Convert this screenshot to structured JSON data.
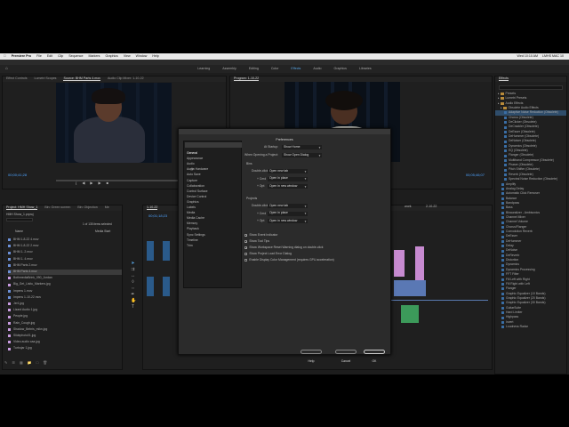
{
  "menubar": {
    "apple": "",
    "app": "Premiere Pro",
    "items": [
      "File",
      "Edit",
      "Clip",
      "Sequence",
      "Markers",
      "Graphics",
      "View",
      "Window",
      "Help"
    ],
    "right": [
      "Wed 10:10 AM",
      "LMHS MAC 10"
    ]
  },
  "titlebar": "/Volumes/ML/HMH Show/HMH Show_1.prproj *",
  "workspaces": [
    "Learning",
    "Assembly",
    "Editing",
    "Color",
    "Effects",
    "Audio",
    "Graphics",
    "Libraries"
  ],
  "active_workspace": "Effects",
  "source_tabs": [
    "Effect Controls",
    "Lumetri Scopes",
    "Source: BHM Parts 4.mov",
    "Audio Clip Mixer: 1-10-22"
  ],
  "program_tab": "Program: 1-10-22",
  "source_timecode": "00;00;41;28",
  "program_timecode_right": "00;05;46;07",
  "project": {
    "tabs": [
      "Project: HMH Show_1",
      "Bin: Green screen",
      "Bin: Objection",
      "Me"
    ],
    "file": "HMH Show_1.prproj",
    "count": "1 of 135 items selected",
    "col_name": "Name",
    "col_rate": "Media Start",
    "rows": [
      {
        "name": "BHM 1-8-22 4.mov",
        "color": "#6b8fd6"
      },
      {
        "name": "BHM 1-8-22 2.mov",
        "color": "#6b8fd6"
      },
      {
        "name": "BHM 1- 2.mov",
        "color": "#6b8fd6"
      },
      {
        "name": "BHM 1- 4.mov",
        "color": "#6b8fd6"
      },
      {
        "name": "BHM Parts 2.mov",
        "color": "#6b8fd6"
      },
      {
        "name": "BHM Parts 4.mov",
        "color": "#6b8fd6"
      },
      {
        "name": "BothmediaBrink_090_Jordan",
        "color": "#c89be0"
      },
      {
        "name": "Big_Get_Lisitu_Markers.jpg",
        "color": "#c89be0"
      },
      {
        "name": "Impens 1.mov",
        "color": "#6b8fd6"
      },
      {
        "name": "Impens 1-10-22.mov",
        "color": "#6b8fd6"
      },
      {
        "name": "Jer1.jpg",
        "color": "#c89be0"
      },
      {
        "name": "Lizard Audio 1.jpg",
        "color": "#c89be0"
      },
      {
        "name": "People.jpg",
        "color": "#c89be0"
      },
      {
        "name": "Rain_Cough.jpg",
        "color": "#c89be0"
      },
      {
        "name": "Shadow_Bebris_mikn.jpg",
        "color": "#c89be0"
      },
      {
        "name": "Slidephoto01.jpg",
        "color": "#c89be0"
      },
      {
        "name": "Video audio caa.jpg",
        "color": "#c89be0"
      },
      {
        "name": "Turbojar 1.jpg",
        "color": "#c89be0"
      }
    ]
  },
  "timeline": {
    "tab": "1-10-22",
    "timecode": "00;01;18;23",
    "tracks": [
      "V3",
      "V2",
      "V1",
      "A1",
      "A2",
      "A3"
    ],
    "ruler": [
      "work",
      "2-10-22"
    ]
  },
  "effects": {
    "title": "Effects",
    "items": [
      {
        "name": "Presets",
        "kind": "folder",
        "indent": 1
      },
      {
        "name": "Lumetri Presets",
        "kind": "folder",
        "indent": 1
      },
      {
        "name": "Audio Effects",
        "kind": "folder",
        "indent": 1
      },
      {
        "name": "Obsolete Audio Effects",
        "kind": "folder",
        "indent": 2
      },
      {
        "name": "Adaptive Noise Reduction (Obsolete)",
        "kind": "fx",
        "indent": 3,
        "selected": true
      },
      {
        "name": "Chorus (Obsolete)",
        "kind": "fx",
        "indent": 3
      },
      {
        "name": "DeClicker (Obsolete)",
        "kind": "fx",
        "indent": 3
      },
      {
        "name": "DeCrackler (Obsolete)",
        "kind": "fx",
        "indent": 3
      },
      {
        "name": "DeEsser (Obsolete)",
        "kind": "fx",
        "indent": 3
      },
      {
        "name": "DeHummer (Obsolete)",
        "kind": "fx",
        "indent": 3
      },
      {
        "name": "DeNoiser (Obsolete)",
        "kind": "fx",
        "indent": 3
      },
      {
        "name": "Dynamics (Obsolete)",
        "kind": "fx",
        "indent": 3
      },
      {
        "name": "EQ (Obsolete)",
        "kind": "fx",
        "indent": 3
      },
      {
        "name": "Flanger (Obsolete)",
        "kind": "fx",
        "indent": 3
      },
      {
        "name": "Multiband Compressor (Obsolete)",
        "kind": "fx",
        "indent": 3
      },
      {
        "name": "Phaser (Obsolete)",
        "kind": "fx",
        "indent": 3
      },
      {
        "name": "Pitch Shifter (Obsolete)",
        "kind": "fx",
        "indent": 3
      },
      {
        "name": "Reverb (Obsolete)",
        "kind": "fx",
        "indent": 3
      },
      {
        "name": "Spectral Noise Reduction (Obsolete)",
        "kind": "fx",
        "indent": 3
      },
      {
        "name": "Amplify",
        "kind": "fx",
        "indent": 2
      },
      {
        "name": "Analog Delay",
        "kind": "fx",
        "indent": 2
      },
      {
        "name": "Automatic Click Remover",
        "kind": "fx",
        "indent": 2
      },
      {
        "name": "Balance",
        "kind": "fx",
        "indent": 2
      },
      {
        "name": "Bandpass",
        "kind": "fx",
        "indent": 2
      },
      {
        "name": "Bass",
        "kind": "fx",
        "indent": 2
      },
      {
        "name": "Binauralizer - Ambisonics",
        "kind": "fx",
        "indent": 2
      },
      {
        "name": "Channel Mixer",
        "kind": "fx",
        "indent": 2
      },
      {
        "name": "Channel Volume",
        "kind": "fx",
        "indent": 2
      },
      {
        "name": "Chorus/Flanger",
        "kind": "fx",
        "indent": 2
      },
      {
        "name": "Convolution Reverb",
        "kind": "fx",
        "indent": 2
      },
      {
        "name": "DeEsser",
        "kind": "fx",
        "indent": 2
      },
      {
        "name": "DeHummer",
        "kind": "fx",
        "indent": 2
      },
      {
        "name": "Delay",
        "kind": "fx",
        "indent": 2
      },
      {
        "name": "DeNoise",
        "kind": "fx",
        "indent": 2
      },
      {
        "name": "DeReverb",
        "kind": "fx",
        "indent": 2
      },
      {
        "name": "Distortion",
        "kind": "fx",
        "indent": 2
      },
      {
        "name": "Dynamics",
        "kind": "fx",
        "indent": 2
      },
      {
        "name": "Dynamics Processing",
        "kind": "fx",
        "indent": 2
      },
      {
        "name": "FFT Filter",
        "kind": "fx",
        "indent": 2
      },
      {
        "name": "Fill Left with Right",
        "kind": "fx",
        "indent": 2
      },
      {
        "name": "Fill Right with Left",
        "kind": "fx",
        "indent": 2
      },
      {
        "name": "Flanger",
        "kind": "fx",
        "indent": 2
      },
      {
        "name": "Graphic Equalizer (10 Bands)",
        "kind": "fx",
        "indent": 2
      },
      {
        "name": "Graphic Equalizer (20 Bands)",
        "kind": "fx",
        "indent": 2
      },
      {
        "name": "Graphic Equalizer (30 Bands)",
        "kind": "fx",
        "indent": 2
      },
      {
        "name": "GuitarSuite",
        "kind": "fx",
        "indent": 2
      },
      {
        "name": "Hard Limiter",
        "kind": "fx",
        "indent": 2
      },
      {
        "name": "Highpass",
        "kind": "fx",
        "indent": 2
      },
      {
        "name": "Invert",
        "kind": "fx",
        "indent": 2
      },
      {
        "name": "Loudness Radar",
        "kind": "fx",
        "indent": 2
      }
    ]
  },
  "dialog": {
    "title": "Preferences",
    "categories": [
      "General",
      "Appearance",
      "Audio",
      "Audio Hardware",
      "Auto Save",
      "Capture",
      "Collaboration",
      "Control Surface",
      "Device Control",
      "Graphics",
      "Labels",
      "Media",
      "Media Cache",
      "Memory",
      "Playback",
      "Sync Settings",
      "Timeline",
      "Trim"
    ],
    "selected": "General",
    "at_startup_label": "At Startup:",
    "at_startup_value": "Show Home",
    "when_opening_label": "When Opening a Project:",
    "when_opening_value": "Show Open Dialog",
    "bins_header": "Bins",
    "projects_header": "Projects",
    "bins_rows": [
      {
        "label": "Double-click",
        "value": "Open new tab"
      },
      {
        "label": "+ Cmd",
        "value": "Open in place"
      },
      {
        "label": "+ Opt",
        "value": "Open in new window"
      }
    ],
    "proj_rows": [
      {
        "label": "Double-click",
        "value": "Open new tab"
      },
      {
        "label": "+ Cmd",
        "value": "Open in place"
      },
      {
        "label": "+ Opt",
        "value": "Open in new window"
      }
    ],
    "checkboxes": [
      {
        "label": "Show Event Indicator",
        "checked": true
      },
      {
        "label": "Show Tool Tips",
        "checked": true
      },
      {
        "label": "Show Workspace Reset Warning dialog on double-click",
        "checked": true
      },
      {
        "label": "Show Project Load Error Dialog",
        "checked": false
      },
      {
        "label": "Enable Display Color Management (requires GPU acceleration)",
        "checked": false
      }
    ],
    "help_label": "Help",
    "cancel_label": "Cancel",
    "ok_label": "OK"
  }
}
